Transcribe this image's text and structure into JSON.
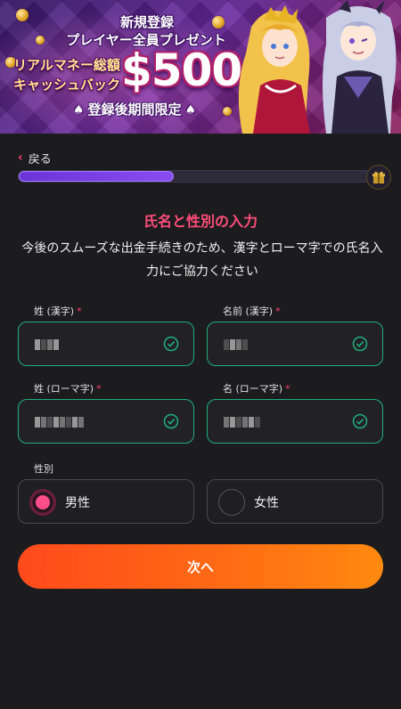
{
  "banner": {
    "line1": "新規登録",
    "line2": "プレイヤー全員プレゼント",
    "line3": "リアルマネー総額",
    "line4": "キャッシュバック",
    "amount": "$500",
    "line5": "登録後期間限定"
  },
  "nav": {
    "back_label": "戻る"
  },
  "progress": {
    "value": 0.44
  },
  "heading": {
    "title": "氏名と性別の入力",
    "description": "今後のスムーズな出金手続きのため、漢字とローマ字での氏名入力にご協力ください"
  },
  "form": {
    "last_name_kanji": {
      "label": "姓 (漢字)",
      "required_mark": "*"
    },
    "first_name_kanji": {
      "label": "名前 (漢字)",
      "required_mark": "*"
    },
    "last_name_roman": {
      "label": "姓 (ローマ字)",
      "required_mark": "*"
    },
    "first_name_roman": {
      "label": "名 (ローマ字)",
      "required_mark": "*"
    },
    "gender": {
      "label": "性別",
      "options": [
        "男性",
        "女性"
      ],
      "selected": "男性"
    }
  },
  "actions": {
    "next_label": "次へ"
  },
  "colors": {
    "accent": "#ff4d7a",
    "valid": "#1fae7a",
    "progress": "#6b34d6",
    "button_start": "#ff4a1c",
    "button_end": "#ff8a10"
  }
}
